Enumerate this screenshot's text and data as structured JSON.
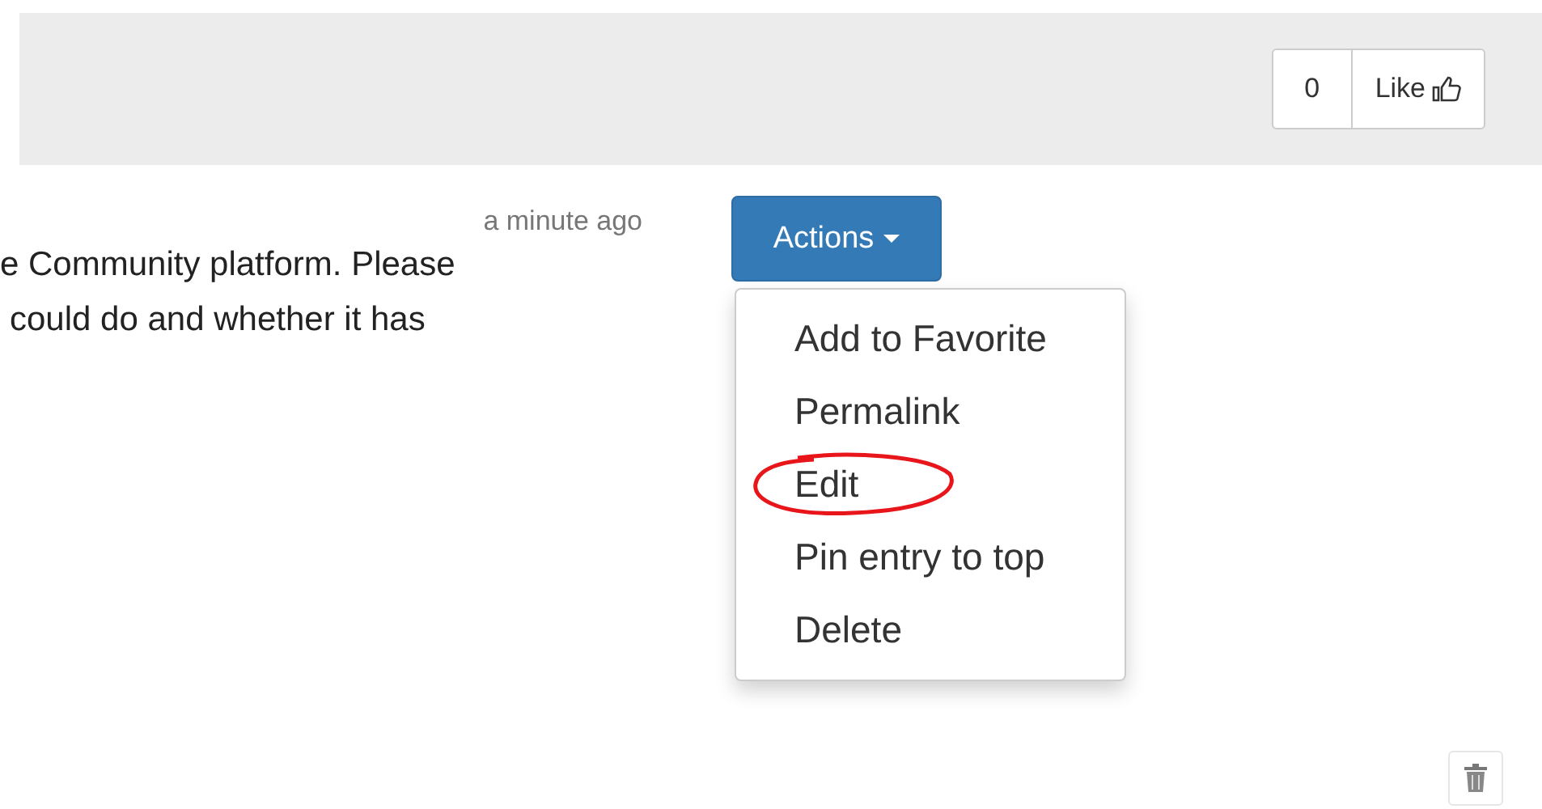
{
  "like_bar": {
    "count": "0",
    "like_label": "Like"
  },
  "post": {
    "time": "a minute ago",
    "lines": [
      "e Community platform. Please",
      "could do and whether it has"
    ]
  },
  "actions": {
    "label": "Actions",
    "expanded": true,
    "menu": [
      {
        "label": "Add to Favorite",
        "highlighted": false
      },
      {
        "label": "Permalink",
        "highlighted": false
      },
      {
        "label": "Edit",
        "highlighted": true
      },
      {
        "label": "Pin entry to top",
        "highlighted": false
      },
      {
        "label": "Delete",
        "highlighted": false
      }
    ]
  }
}
